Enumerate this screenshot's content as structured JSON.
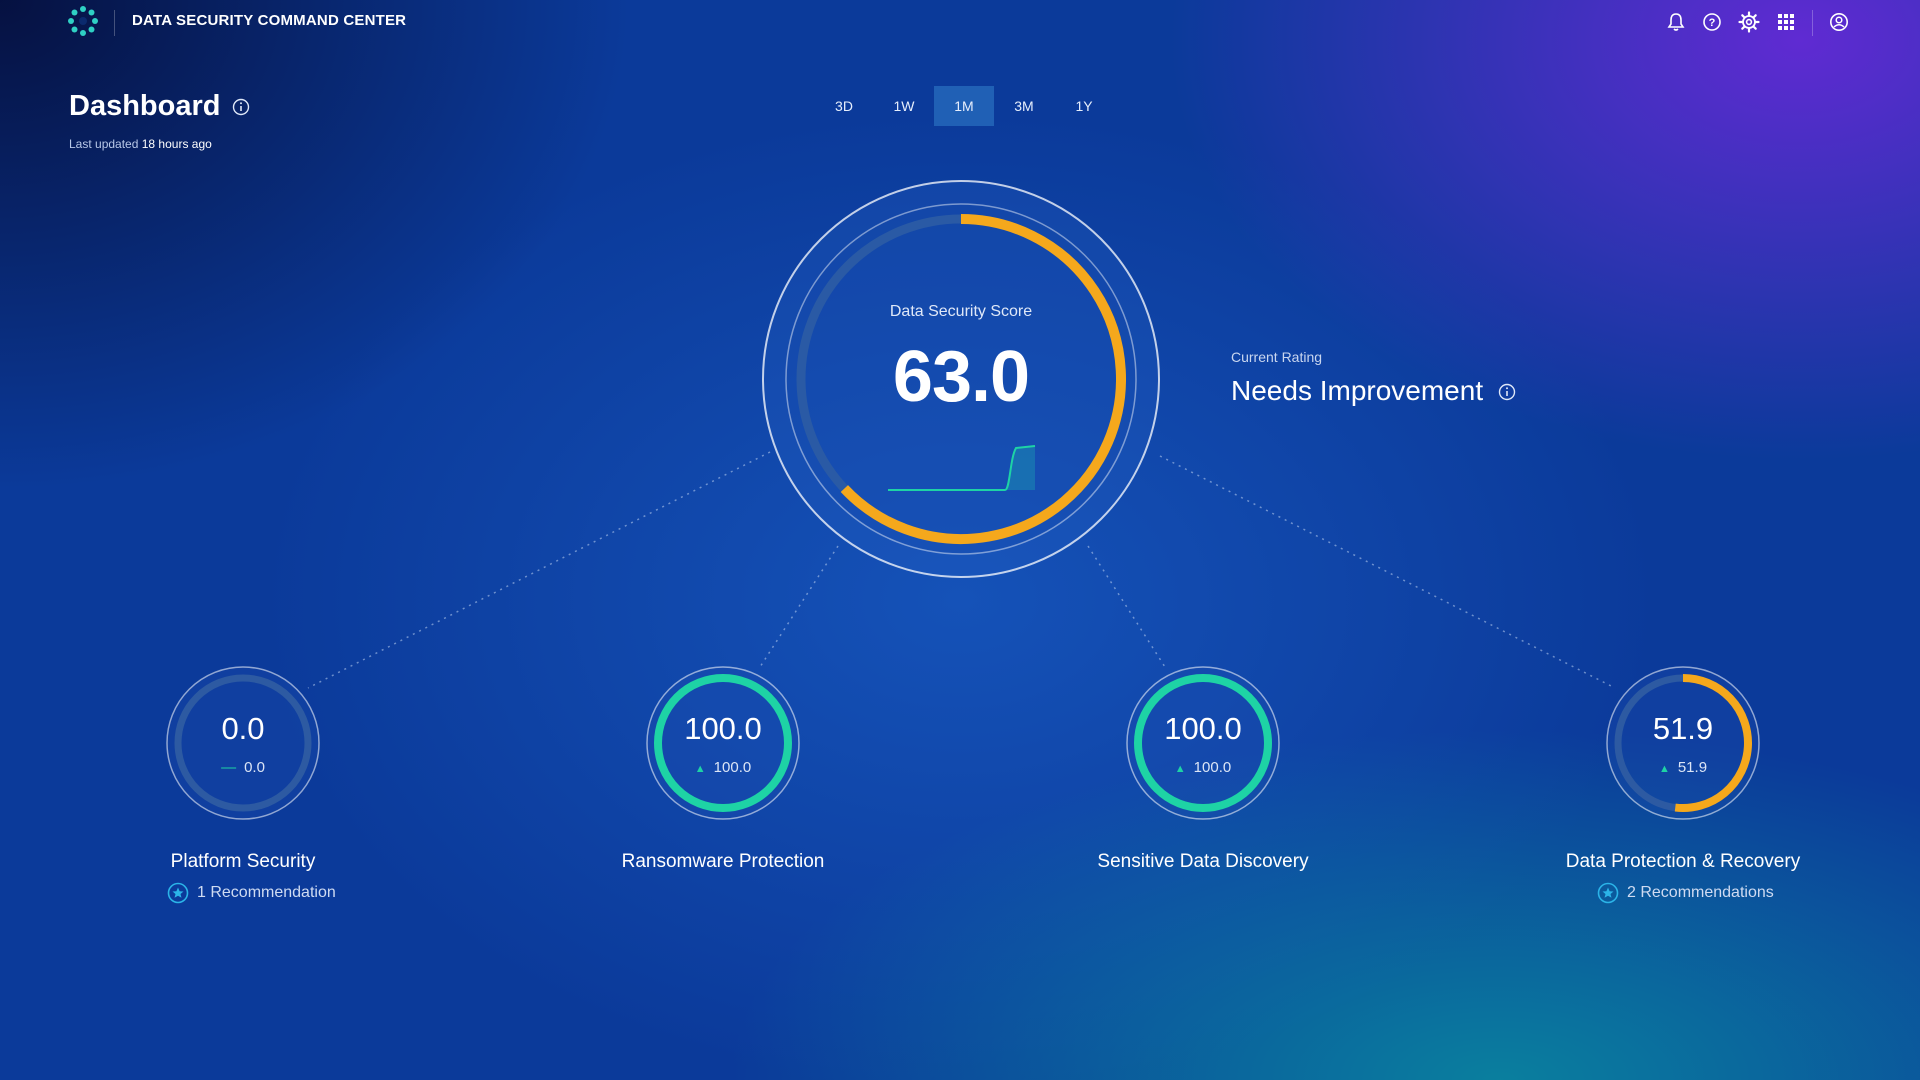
{
  "header": {
    "app_title": "DATA SECURITY COMMAND CENTER",
    "icons": [
      "bell-icon",
      "help-icon",
      "gear-icon",
      "apps-grid-icon",
      "user-icon"
    ]
  },
  "page": {
    "title": "Dashboard",
    "last_updated_prefix": "Last updated",
    "last_updated_value": "18 hours ago"
  },
  "time_range": {
    "options": [
      "3D",
      "1W",
      "1M",
      "3M",
      "1Y"
    ],
    "selected": "1M"
  },
  "score": {
    "label": "Data Security Score",
    "value": "63.0",
    "fraction": 0.63
  },
  "rating": {
    "label": "Current Rating",
    "value": "Needs Improvement"
  },
  "categories": [
    {
      "title": "Platform Security",
      "value": "0.0",
      "delta": "0.0",
      "trend": "flat",
      "fraction": 0.0,
      "recommendation": "1 Recommendation"
    },
    {
      "title": "Ransomware Protection",
      "value": "100.0",
      "delta": "100.0",
      "trend": "up",
      "fraction": 1.0,
      "recommendation": ""
    },
    {
      "title": "Sensitive Data Discovery",
      "value": "100.0",
      "delta": "100.0",
      "trend": "up",
      "fraction": 1.0,
      "recommendation": ""
    },
    {
      "title": "Data Protection & Recovery",
      "value": "51.9",
      "delta": "51.9",
      "trend": "up",
      "fraction": 0.519,
      "recommendation": "2 Recommendations"
    }
  ],
  "colors": {
    "warning": "#f5a81c",
    "good": "#1ed3a5",
    "track": "#2b5aa6"
  }
}
